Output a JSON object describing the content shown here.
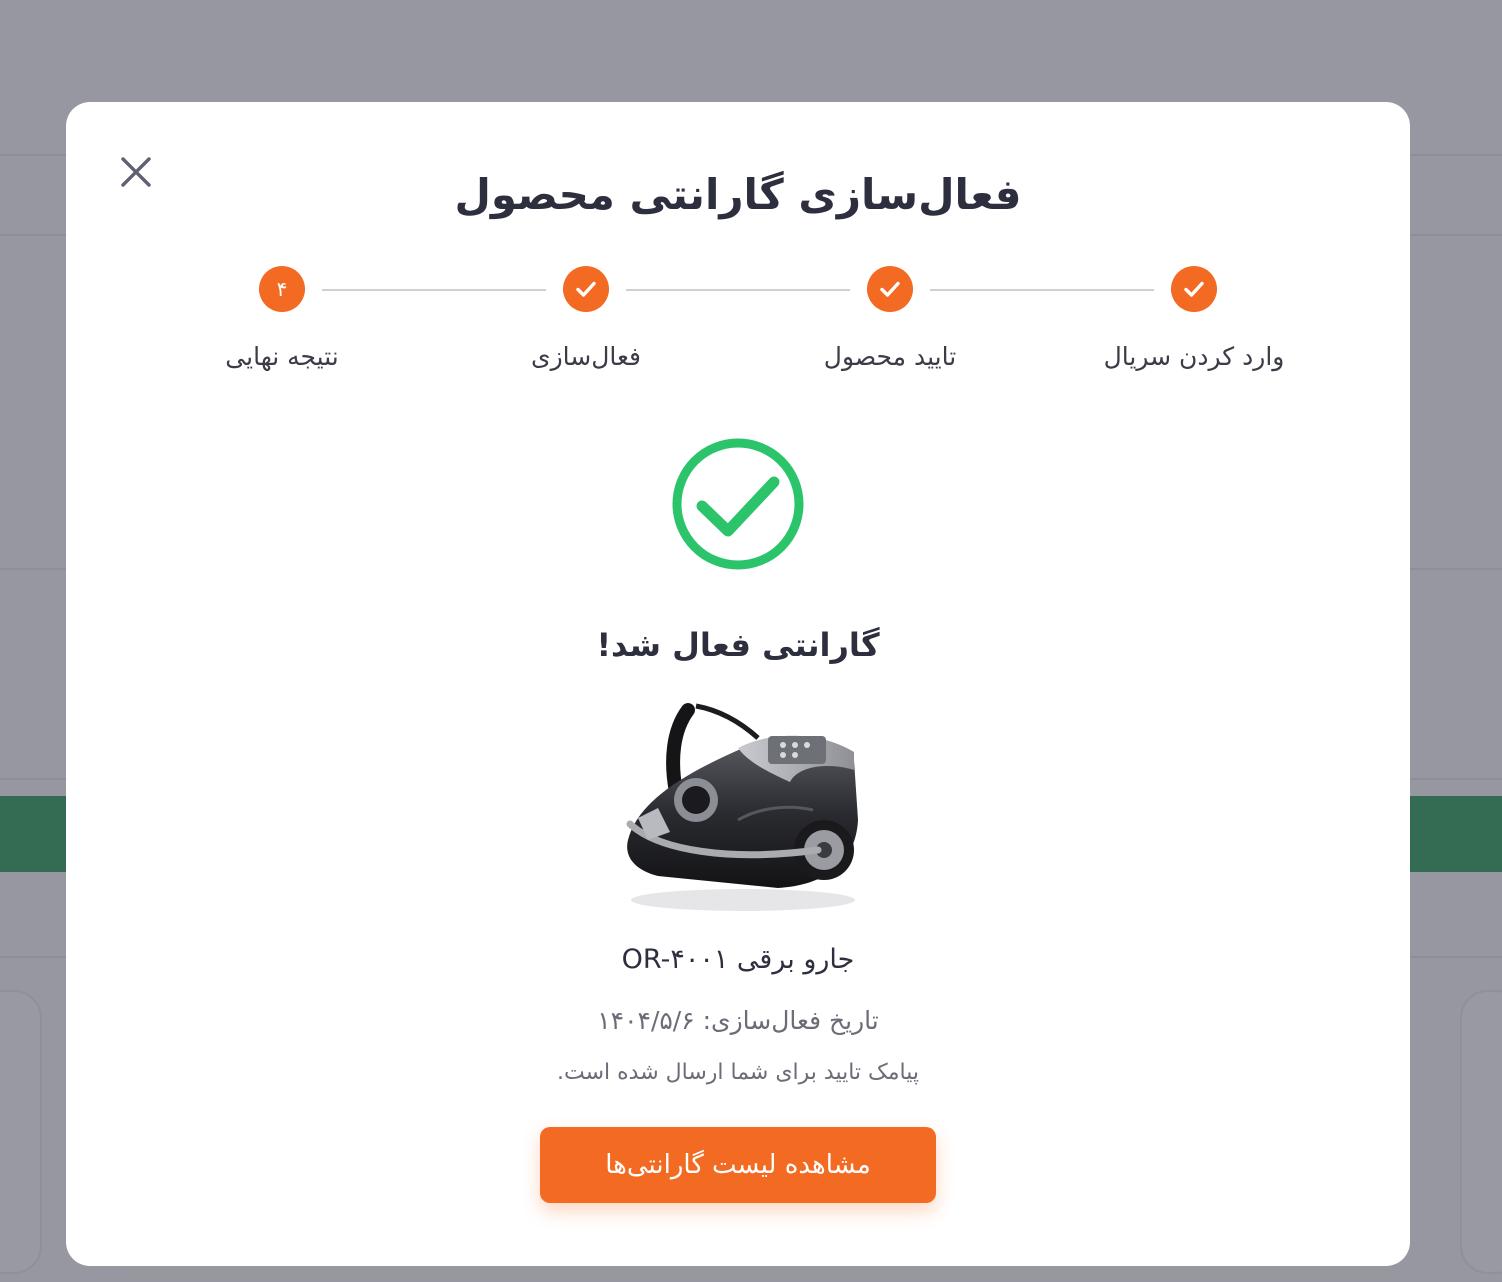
{
  "modal": {
    "title": "فعال‌سازی گارانتی محصول"
  },
  "steps": [
    {
      "label": "وارد کردن سریال",
      "state": "done"
    },
    {
      "label": "تایید محصول",
      "state": "done"
    },
    {
      "label": "فعال‌سازی",
      "state": "done"
    },
    {
      "label": "نتیجه نهایی",
      "state": "current",
      "number": "۴"
    }
  ],
  "result": {
    "title": "گارانتی فعال شد!",
    "product_name": "جارو برقی OR-۴۰۰۱",
    "activation_date": "تاریخ فعال‌سازی: ۱۴۰۴/۵/۶",
    "sms_note": "پیامک تایید برای شما ارسال شده است.",
    "button_label": "مشاهده لیست گارانتی‌ها"
  },
  "icons": {
    "close": "close-icon",
    "step_done": "check-icon",
    "success": "success-check-icon",
    "product": "vacuum-cleaner-image"
  },
  "colors": {
    "accent": "#f36a22",
    "success": "#2bc46b",
    "title_text": "#2e2f3e",
    "muted_text": "#6b6c78"
  }
}
